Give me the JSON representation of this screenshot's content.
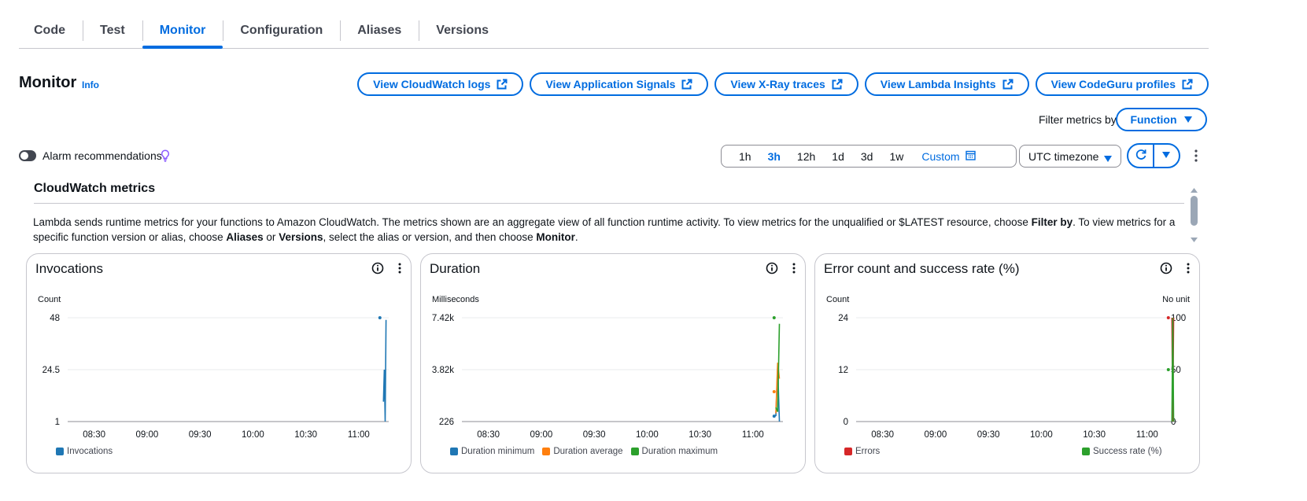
{
  "tabs": [
    {
      "label": "Code",
      "active": false
    },
    {
      "label": "Test",
      "active": false
    },
    {
      "label": "Monitor",
      "active": true
    },
    {
      "label": "Configuration",
      "active": false
    },
    {
      "label": "Aliases",
      "active": false
    },
    {
      "label": "Versions",
      "active": false
    }
  ],
  "header": {
    "title": "Monitor",
    "info": "Info",
    "actions": [
      "View CloudWatch logs",
      "View Application Signals",
      "View X-Ray traces",
      "View Lambda Insights",
      "View CodeGuru profiles"
    ],
    "filter_label": "Filter metrics by",
    "filter_value": "Function"
  },
  "controls": {
    "alarm_label": "Alarm recommendations",
    "alarm_enabled": false,
    "time_ranges": [
      "1h",
      "3h",
      "12h",
      "1d",
      "3d",
      "1w"
    ],
    "active_range": "3h",
    "custom_label": "Custom",
    "timezone": "UTC timezone"
  },
  "section": {
    "title": "CloudWatch metrics",
    "desc": {
      "p1": "Lambda sends runtime metrics for your functions to Amazon CloudWatch. The metrics shown are an aggregate view of all function runtime activity. To view metrics for the unqualified or $LATEST resource, choose ",
      "b1": "Filter by",
      "p2": ". To view metrics for a specific function version or alias, choose ",
      "b2": "Aliases",
      "p3": " or ",
      "b3": "Versions",
      "p4": ", select the alias or version, and then choose ",
      "b4": "Monitor",
      "p5": "."
    }
  },
  "colors": {
    "accent": "#006ce0",
    "blue": "#1f77b4",
    "orange": "#ff7f0e",
    "green": "#2ca02c",
    "red": "#d62728"
  },
  "chart_data": [
    {
      "type": "line",
      "title": "Invocations",
      "ylabel": "Count",
      "y_ticks": [
        "48",
        "24.5",
        "1"
      ],
      "ylim": [
        1,
        48
      ],
      "x_ticks": [
        "08:30",
        "09:00",
        "09:30",
        "10:00",
        "10:30",
        "11:00"
      ],
      "series": [
        {
          "name": "Invocations",
          "color": "#1f77b4",
          "points": [
            [
              "11:14",
              10
            ],
            [
              "11:14.5",
              24.5
            ],
            [
              "11:15",
              1
            ],
            [
              "11:15.5",
              47
            ]
          ]
        }
      ],
      "dots": [
        {
          "x": "11:12",
          "y": 48,
          "color": "#1f77b4"
        }
      ]
    },
    {
      "type": "line",
      "title": "Duration",
      "ylabel": "Milliseconds",
      "y_ticks": [
        "7.42k",
        "3.82k",
        "226"
      ],
      "ylim": [
        226,
        7420
      ],
      "x_ticks": [
        "08:30",
        "09:00",
        "09:30",
        "10:00",
        "10:30",
        "11:00"
      ],
      "series": [
        {
          "name": "Duration minimum",
          "color": "#1f77b4",
          "points": [
            [
              "11:13",
              600
            ],
            [
              "11:14",
              4100
            ],
            [
              "11:15",
              226
            ]
          ]
        },
        {
          "name": "Duration average",
          "color": "#ff7f0e",
          "points": [
            [
              "11:13",
              800
            ],
            [
              "11:14",
              4300
            ],
            [
              "11:15",
              3200
            ]
          ]
        },
        {
          "name": "Duration maximum",
          "color": "#2ca02c",
          "points": [
            [
              "11:13",
              1200
            ],
            [
              "11:14",
              900
            ],
            [
              "11:15",
              7000
            ]
          ]
        }
      ],
      "dots": [
        {
          "x": "11:12",
          "y": 7420,
          "color": "#2ca02c"
        },
        {
          "x": "11:12",
          "y": 2300,
          "color": "#ff7f0e"
        },
        {
          "x": "11:12",
          "y": 600,
          "color": "#1f77b4"
        }
      ]
    },
    {
      "type": "line",
      "title": "Error count and success rate (%)",
      "ylabel": "Count",
      "y2label": "No unit",
      "y_ticks": [
        "24",
        "12",
        "0"
      ],
      "y2_ticks": [
        "100",
        "50",
        "0"
      ],
      "ylim": [
        0,
        24
      ],
      "y2lim": [
        0,
        100
      ],
      "x_ticks": [
        "08:30",
        "09:00",
        "09:30",
        "10:00",
        "10:30",
        "11:00"
      ],
      "series": [
        {
          "name": "Errors",
          "color": "#d62728",
          "points": [
            [
              "11:14",
              24
            ],
            [
              "11:14.5",
              0
            ],
            [
              "11:15",
              24
            ]
          ]
        },
        {
          "name": "Success rate (%)",
          "color": "#2ca02c",
          "points": [
            [
              "11:14",
              0
            ],
            [
              "11:14.5",
              100
            ],
            [
              "11:15",
              0
            ]
          ]
        }
      ],
      "dots": [
        {
          "x": "11:12",
          "y": 24,
          "color": "#d62728"
        },
        {
          "x": "11:12",
          "y": 12,
          "color": "#2ca02c"
        }
      ]
    }
  ]
}
